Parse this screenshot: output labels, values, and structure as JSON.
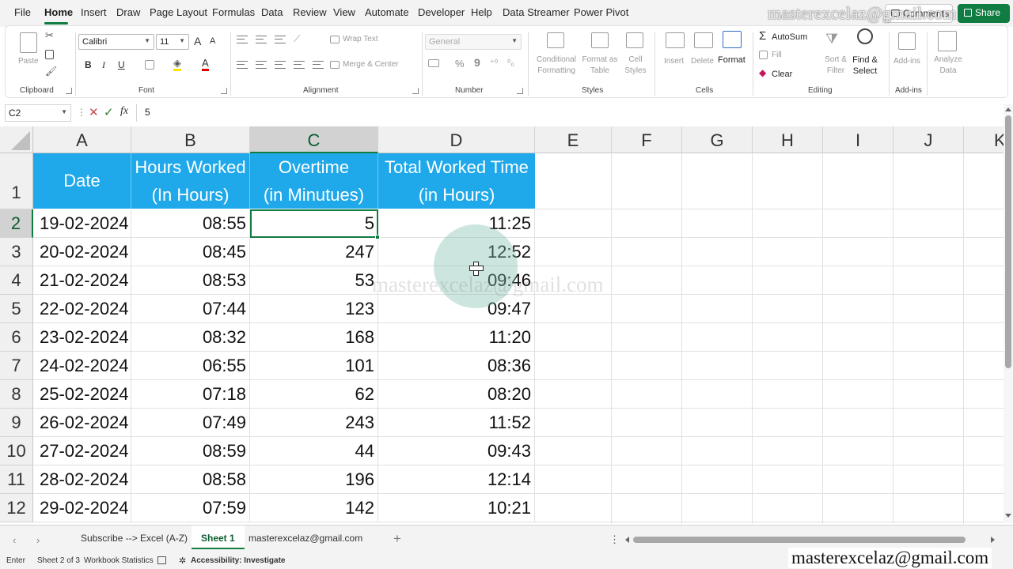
{
  "menu": {
    "tabs": [
      "File",
      "Home",
      "Insert",
      "Draw",
      "Page Layout",
      "Formulas",
      "Data",
      "Review",
      "View",
      "Automate",
      "Developer",
      "Help",
      "Data Streamer",
      "Power Pivot"
    ],
    "comments_label": "Comments",
    "share_label": "Share"
  },
  "ribbon": {
    "clipboard": {
      "paste": "Paste",
      "label": "Clipboard"
    },
    "font": {
      "name": "Calibri",
      "size": "11",
      "label": "Font",
      "bold": "B",
      "italic": "I",
      "underline": "U",
      "grow": "A",
      "shrink": "A"
    },
    "alignment": {
      "wrap": "Wrap Text",
      "merge": "Merge & Center",
      "label": "Alignment"
    },
    "number": {
      "format": "General",
      "label": "Number",
      "percent": "%",
      "comma": "9"
    },
    "styles": {
      "conditional": "Conditional Formatting",
      "format_table": "Format as Table",
      "cell_styles": "Cell Styles",
      "label": "Styles"
    },
    "cells": {
      "insert": "Insert",
      "delete": "Delete",
      "format": "Format",
      "label": "Cells"
    },
    "editing": {
      "autosum": "AutoSum",
      "fill": "Fill",
      "clear": "Clear",
      "sort": "Sort & Filter",
      "find": "Find & Select",
      "label": "Editing"
    },
    "addins": {
      "addins": "Add-ins",
      "label": "Add-ins"
    },
    "analyze": {
      "label": "Analyze Data"
    }
  },
  "formula_bar": {
    "name_box": "C2",
    "content": "5",
    "fx": "fx",
    "cancel": "✕",
    "enter": "✓"
  },
  "columns": [
    "A",
    "B",
    "C",
    "D",
    "E",
    "F",
    "G",
    "H",
    "I",
    "J",
    "K"
  ],
  "row_numbers": [
    "1",
    "2",
    "3",
    "4",
    "5",
    "6",
    "7",
    "8",
    "9",
    "10",
    "11",
    "12"
  ],
  "headers": {
    "date": "Date",
    "hours_1": "Hours Worked",
    "hours_2": "(In Hours)",
    "overtime_1": "Overtime",
    "overtime_2": "(in Minutues)",
    "total_1": "Total Worked Time",
    "total_2": "(in Hours)"
  },
  "rows": [
    {
      "date": "19-02-2024",
      "hours": "08:55",
      "overtime": "5",
      "total": "11:25"
    },
    {
      "date": "20-02-2024",
      "hours": "08:45",
      "overtime": "247",
      "total": "12:52"
    },
    {
      "date": "21-02-2024",
      "hours": "08:53",
      "overtime": "53",
      "total": "09:46"
    },
    {
      "date": "22-02-2024",
      "hours": "07:44",
      "overtime": "123",
      "total": "09:47"
    },
    {
      "date": "23-02-2024",
      "hours": "08:32",
      "overtime": "168",
      "total": "11:20"
    },
    {
      "date": "24-02-2024",
      "hours": "06:55",
      "overtime": "101",
      "total": "08:36"
    },
    {
      "date": "25-02-2024",
      "hours": "07:18",
      "overtime": "62",
      "total": "08:20"
    },
    {
      "date": "26-02-2024",
      "hours": "07:49",
      "overtime": "243",
      "total": "11:52"
    },
    {
      "date": "27-02-2024",
      "hours": "08:59",
      "overtime": "44",
      "total": "09:43"
    },
    {
      "date": "28-02-2024",
      "hours": "08:58",
      "overtime": "196",
      "total": "12:14"
    },
    {
      "date": "29-02-2024",
      "hours": "07:59",
      "overtime": "142",
      "total": "10:21"
    }
  ],
  "sheet_tabs": {
    "tabs": [
      "Subscribe --> Excel (A-Z)",
      "Sheet 1",
      "masterexcelaz@gmail.com"
    ],
    "active": "Sheet 1",
    "add": "+",
    "more": "⋮"
  },
  "status": {
    "mode": "Enter",
    "sheet_info": "Sheet 2 of 3",
    "workbook_stats": "Workbook Statistics",
    "accessibility": "Accessibility: Investigate"
  },
  "watermark": "masterexcelaz@gmail.com",
  "colors": {
    "header_fill": "#1fa9ea",
    "header_text": "#ffffff",
    "excel_green": "#107c41"
  }
}
